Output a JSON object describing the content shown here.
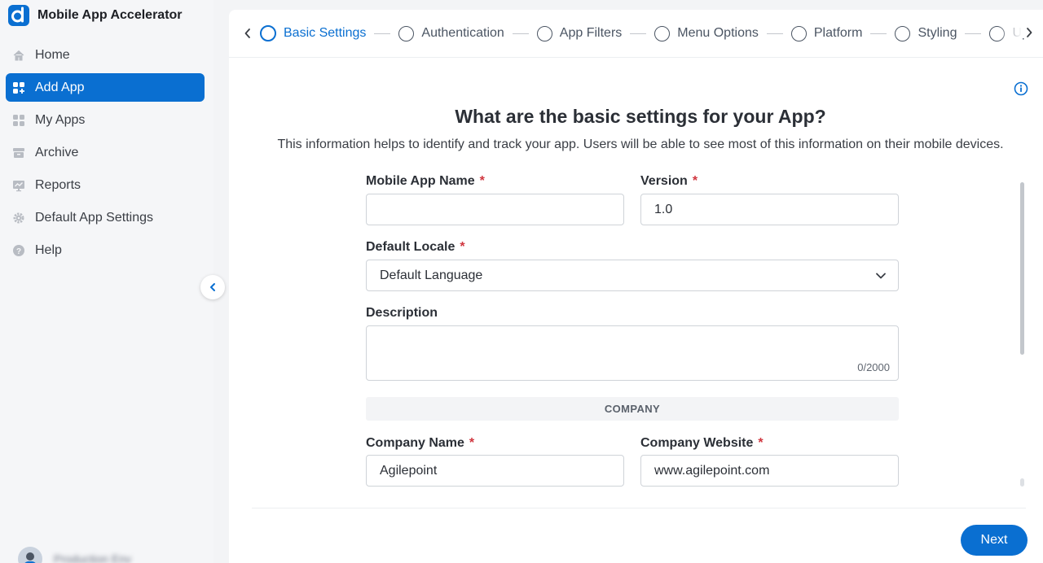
{
  "app": {
    "title": "Mobile App Accelerator",
    "accent": "#0a6fd1"
  },
  "sidebar": {
    "items": [
      {
        "label": "Home",
        "icon": "home-icon",
        "active": false
      },
      {
        "label": "Add App",
        "icon": "add-app-icon",
        "active": true
      },
      {
        "label": "My Apps",
        "icon": "grid-icon",
        "active": false
      },
      {
        "label": "Archive",
        "icon": "archive-icon",
        "active": false
      },
      {
        "label": "Reports",
        "icon": "reports-icon",
        "active": false
      },
      {
        "label": "Default App Settings",
        "icon": "gear-icon",
        "active": false
      },
      {
        "label": "Help",
        "icon": "help-icon",
        "active": false
      }
    ],
    "user": {
      "name": "Production Env"
    }
  },
  "stepper": {
    "steps": [
      {
        "label": "Basic Settings",
        "active": true
      },
      {
        "label": "Authentication",
        "active": false
      },
      {
        "label": "App Filters",
        "active": false
      },
      {
        "label": "Menu Options",
        "active": false
      },
      {
        "label": "Platform",
        "active": false
      },
      {
        "label": "Styling",
        "active": false
      },
      {
        "label": "Up",
        "active": false
      }
    ]
  },
  "page": {
    "heading": "What are the basic settings for your App?",
    "subheading": "This information helps to identify and track your app. Users will be able to see most of this information on their mobile devices."
  },
  "form": {
    "app_name": {
      "label": "Mobile App Name",
      "value": "",
      "required": "*"
    },
    "version": {
      "label": "Version",
      "value": "1.0",
      "required": "*"
    },
    "locale": {
      "label": "Default Locale",
      "value": "Default Language",
      "required": "*"
    },
    "description": {
      "label": "Description",
      "counter": "0/2000"
    },
    "company_section": "COMPANY",
    "company_name": {
      "label": "Company Name",
      "value": "Agilepoint",
      "required": "*"
    },
    "company_website": {
      "label": "Company Website",
      "value": "www.agilepoint.com",
      "required": "*"
    }
  },
  "footer": {
    "next_label": "Next"
  }
}
